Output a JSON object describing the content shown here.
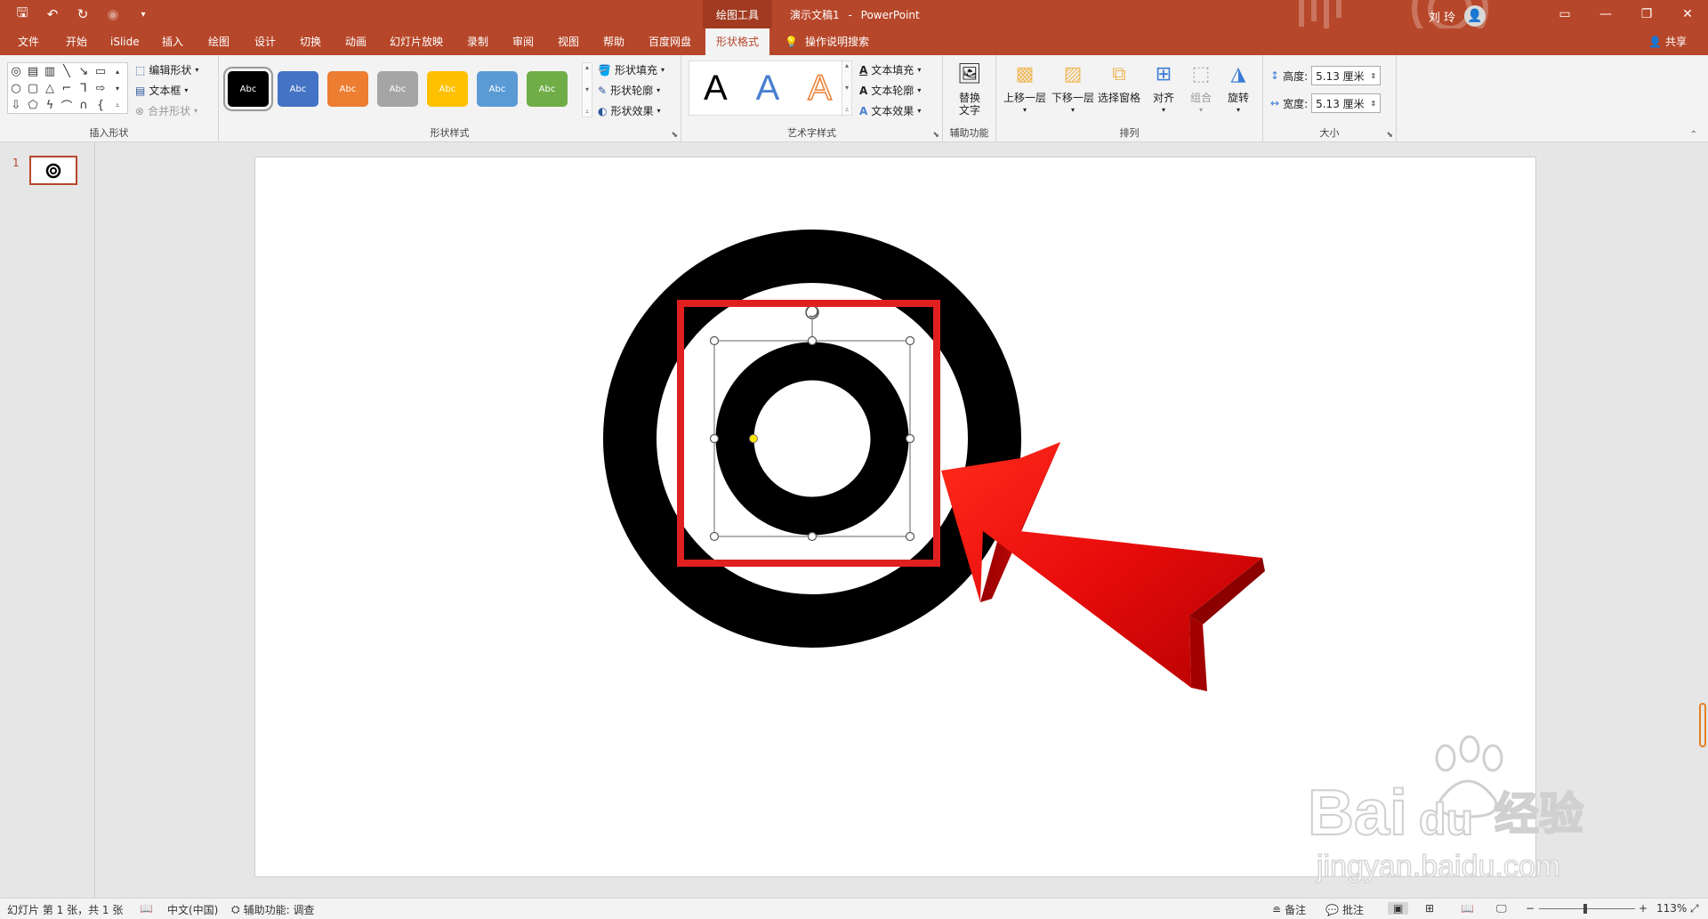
{
  "titlebar": {
    "context_group": "绘图工具",
    "doc_name": "演示文稿1",
    "separator": "-",
    "app_name": "PowerPoint",
    "user_name": "刘 玲"
  },
  "tabs": [
    "文件",
    "开始",
    "iSlide",
    "插入",
    "绘图",
    "设计",
    "切换",
    "动画",
    "幻灯片放映",
    "录制",
    "审阅",
    "视图",
    "帮助",
    "百度网盘"
  ],
  "active_tab": "形状格式",
  "tell_me": "操作说明搜索",
  "share": "共享",
  "ribbon": {
    "insert_shapes": {
      "label": "插入形状",
      "edit_shape": "编辑形状",
      "text_box": "文本框",
      "merge_shapes": "合并形状"
    },
    "shape_styles": {
      "label": "形状样式",
      "styles": [
        {
          "text": "Abc",
          "color": "#000000"
        },
        {
          "text": "Abc",
          "color": "#4472c4"
        },
        {
          "text": "Abc",
          "color": "#ed7d31"
        },
        {
          "text": "Abc",
          "color": "#a5a5a5"
        },
        {
          "text": "Abc",
          "color": "#ffc000"
        },
        {
          "text": "Abc",
          "color": "#5b9bd5"
        },
        {
          "text": "Abc",
          "color": "#70ad47"
        }
      ],
      "fill": "形状填充",
      "outline": "形状轮廓",
      "effects": "形状效果"
    },
    "wordart": {
      "label": "艺术字样式",
      "samples": [
        "A",
        "A",
        "A"
      ],
      "text_fill": "文本填充",
      "text_outline": "文本轮廓",
      "text_effects": "文本效果"
    },
    "accessibility": {
      "label": "辅助功能",
      "alt_text_line1": "替换",
      "alt_text_line2": "文字"
    },
    "arrange": {
      "label": "排列",
      "bring_forward": "上移一层",
      "send_backward": "下移一层",
      "selection_pane": "选择窗格",
      "align": "对齐",
      "group": "组合",
      "rotate": "旋转"
    },
    "size": {
      "label": "大小",
      "height_label": "高度:",
      "height_value": "5.13 厘米",
      "width_label": "宽度:",
      "width_value": "5.13 厘米"
    }
  },
  "slides_pane": {
    "slide_number": "1"
  },
  "statusbar": {
    "slide_info": "幻灯片 第 1 张，共 1 张",
    "language": "中文(中国)",
    "accessibility": "辅助功能: 调查",
    "notes": "备注",
    "comments": "批注",
    "zoom": "113%"
  },
  "colors": {
    "brand": "#b7472a",
    "highlight_box": "#e02020",
    "arrow": "#e01010"
  }
}
